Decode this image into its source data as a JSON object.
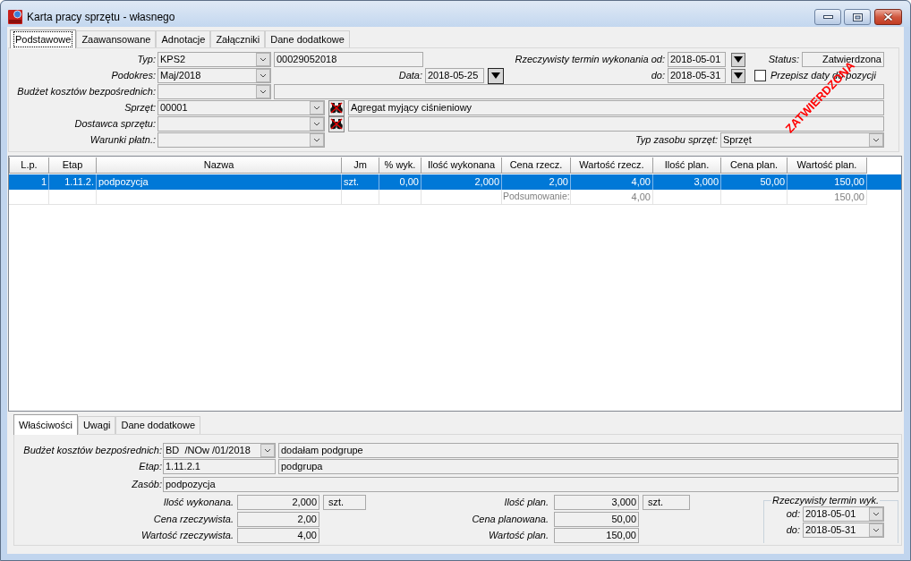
{
  "window": {
    "title": "Karta pracy sprzętu - własnego"
  },
  "tabs": [
    {
      "label": "Podstawowe",
      "selected": true
    },
    {
      "label": "Zaawansowane",
      "selected": false
    },
    {
      "label": "Adnotacje",
      "selected": false
    },
    {
      "label": "Załączniki",
      "selected": false
    },
    {
      "label": "Dane dodatkowe",
      "selected": false
    }
  ],
  "header_form": {
    "typ": {
      "label": "Typ:",
      "value": "KPS2",
      "number": "00029052018"
    },
    "termin_od": {
      "label": "Rzeczywisty termin wykonania od:",
      "value": "2018-05-01"
    },
    "status": {
      "label": "Status:",
      "value": "Zatwierdzona"
    },
    "podokres": {
      "label": "Podokres:",
      "value": "Maj/2018"
    },
    "data": {
      "label": "Data:",
      "value": "2018-05-25"
    },
    "termin_do": {
      "label": "do:",
      "value": "2018-05-31"
    },
    "przepisz_daty": {
      "label": "Przepisz daty do pozycji",
      "checked": false
    },
    "budzet": {
      "label": "Budżet kosztów bezpośrednich:"
    },
    "sprzet": {
      "label": "Sprzęt:",
      "value": "00001",
      "description": "Agregat myjący ciśnieniowy"
    },
    "dostawca": {
      "label": "Dostawca sprzętu:"
    },
    "warunki": {
      "label": "Warunki płatn.:"
    },
    "typ_zasobu": {
      "label": "Typ zasobu sprzęt:",
      "value": "Sprzęt"
    }
  },
  "stamp": {
    "text": "ZATWIERDZONA"
  },
  "table": {
    "columns": [
      "L.p.",
      "Etap",
      "Nazwa",
      "Jm",
      "% wyk.",
      "Ilość wykonana",
      "Cena rzecz.",
      "Wartość rzecz.",
      "Ilość plan.",
      "Cena plan.",
      "Wartość plan."
    ],
    "rows": [
      {
        "selected": true,
        "cells": [
          "1",
          "1.11.2.",
          "podpozycja",
          "szt.",
          "0,00",
          "2,000",
          "2,00",
          "4,00",
          "3,000",
          "50,00",
          "150,00"
        ]
      }
    ],
    "summary": {
      "label": "Podsumowanie:",
      "wartosc_rzecz": "4,00",
      "wartosc_plan": "150,00"
    }
  },
  "detail_tabs": [
    {
      "label": "Właściwości",
      "selected": true
    },
    {
      "label": "Uwagi",
      "selected": false
    },
    {
      "label": "Dane dodatkowe",
      "selected": false
    }
  ],
  "details": {
    "budzet": {
      "label": "Budżet kosztów bezpośrednich:",
      "value": "BD  /NOw /01/2018",
      "description": "dodałam podgrupe"
    },
    "etap": {
      "label": "Etap:",
      "value": "1.11.2.1",
      "description": "podgrupa"
    },
    "zasob": {
      "label": "Zasób:",
      "value": "podpozycja"
    },
    "actual": [
      {
        "label": "Ilość wykonana.",
        "value": "2,000",
        "unit": "szt."
      },
      {
        "label": "Cena rzeczywista.",
        "value": "2,00"
      },
      {
        "label": "Wartość rzeczywista.",
        "value": "4,00"
      }
    ],
    "planned": [
      {
        "label": "Ilość plan.",
        "value": "3,000",
        "unit": "szt."
      },
      {
        "label": "Cena planowana.",
        "value": "50,00"
      },
      {
        "label": "Wartość plan.",
        "value": "150,00"
      }
    ],
    "termin": {
      "title": "Rzeczywisty termin wyk.",
      "od": {
        "label": "od:",
        "value": "2018-05-01"
      },
      "do": {
        "label": "do:",
        "value": "2018-05-31"
      }
    }
  }
}
